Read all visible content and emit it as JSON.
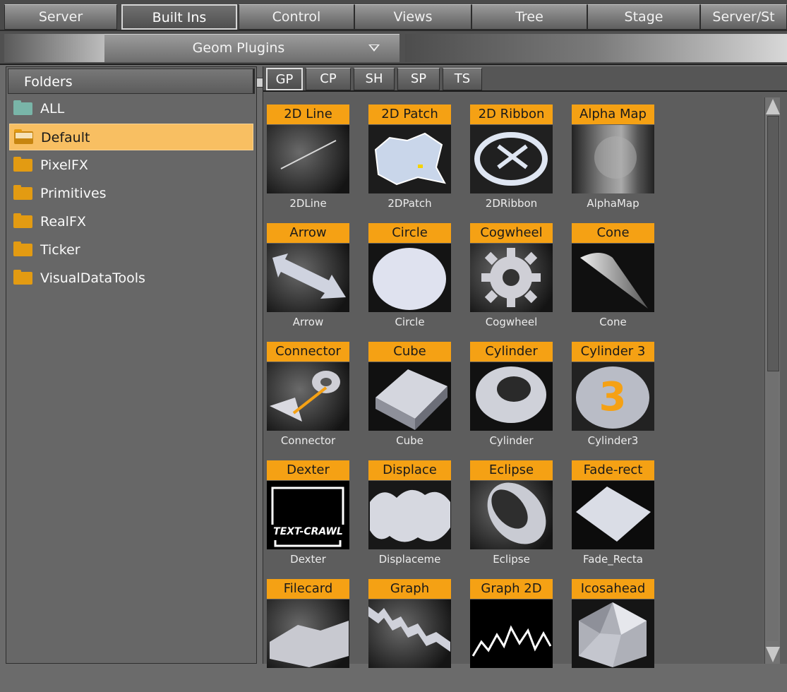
{
  "top_tabs": [
    {
      "label": "Server",
      "active": false
    },
    {
      "label": "Built Ins",
      "active": true
    },
    {
      "label": "Control",
      "active": false
    },
    {
      "label": "Views",
      "active": false
    },
    {
      "label": "Tree",
      "active": false
    },
    {
      "label": "Stage",
      "active": false
    },
    {
      "label": "Server/St",
      "active": false
    }
  ],
  "dropdown": {
    "selected": "Geom Plugins"
  },
  "folders": {
    "header": "Folders",
    "items": [
      {
        "label": "ALL",
        "icon": "teal-folder-icon"
      },
      {
        "label": "Default",
        "icon": "open-folder-icon",
        "selected": true
      },
      {
        "label": "PixelFX",
        "icon": "folder-icon"
      },
      {
        "label": "Primitives",
        "icon": "folder-icon"
      },
      {
        "label": "RealFX",
        "icon": "folder-icon"
      },
      {
        "label": "Ticker",
        "icon": "folder-icon"
      },
      {
        "label": "VisualDataTools",
        "icon": "folder-icon"
      }
    ]
  },
  "sub_tabs": [
    {
      "label": "GP",
      "active": true
    },
    {
      "label": "CP",
      "active": false
    },
    {
      "label": "SH",
      "active": false
    },
    {
      "label": "SP",
      "active": false
    },
    {
      "label": "TS",
      "active": false
    }
  ],
  "plugins": [
    {
      "title": "2D Line",
      "caption": "2DLine",
      "icon": "2d-line-icon"
    },
    {
      "title": "2D Patch",
      "caption": "2DPatch",
      "icon": "2d-patch-icon"
    },
    {
      "title": "2D Ribbon",
      "caption": "2DRibbon",
      "icon": "2d-ribbon-icon"
    },
    {
      "title": "Alpha Map",
      "caption": "AlphaMap",
      "icon": "alpha-map-icon"
    },
    {
      "title": "Arrow",
      "caption": "Arrow",
      "icon": "arrow-icon"
    },
    {
      "title": "Circle",
      "caption": "Circle",
      "icon": "circle-icon"
    },
    {
      "title": "Cogwheel",
      "caption": "Cogwheel",
      "icon": "cogwheel-icon"
    },
    {
      "title": "Cone",
      "caption": "Cone",
      "icon": "cone-icon"
    },
    {
      "title": "Connector",
      "caption": "Connector",
      "icon": "connector-icon"
    },
    {
      "title": "Cube",
      "caption": "Cube",
      "icon": "cube-icon"
    },
    {
      "title": "Cylinder",
      "caption": "Cylinder",
      "icon": "cylinder-icon"
    },
    {
      "title": "Cylinder 3",
      "caption": "Cylinder3",
      "icon": "cylinder3-icon"
    },
    {
      "title": "Dexter",
      "caption": "Dexter",
      "icon": "dexter-icon",
      "thumb_text": "TEXT-CRAWL"
    },
    {
      "title": "Displace",
      "caption": "Displaceme",
      "icon": "displace-icon"
    },
    {
      "title": "Eclipse",
      "caption": "Eclipse",
      "icon": "eclipse-icon"
    },
    {
      "title": "Fade-rect",
      "caption": "Fade_Recta",
      "icon": "fade-rect-icon"
    },
    {
      "title": "Filecard",
      "caption": "",
      "icon": "filecard-icon"
    },
    {
      "title": "Graph",
      "caption": "",
      "icon": "graph-icon"
    },
    {
      "title": "Graph 2D",
      "caption": "",
      "icon": "graph-2d-icon"
    },
    {
      "title": "Icosahead",
      "caption": "",
      "icon": "icosahead-icon"
    }
  ]
}
